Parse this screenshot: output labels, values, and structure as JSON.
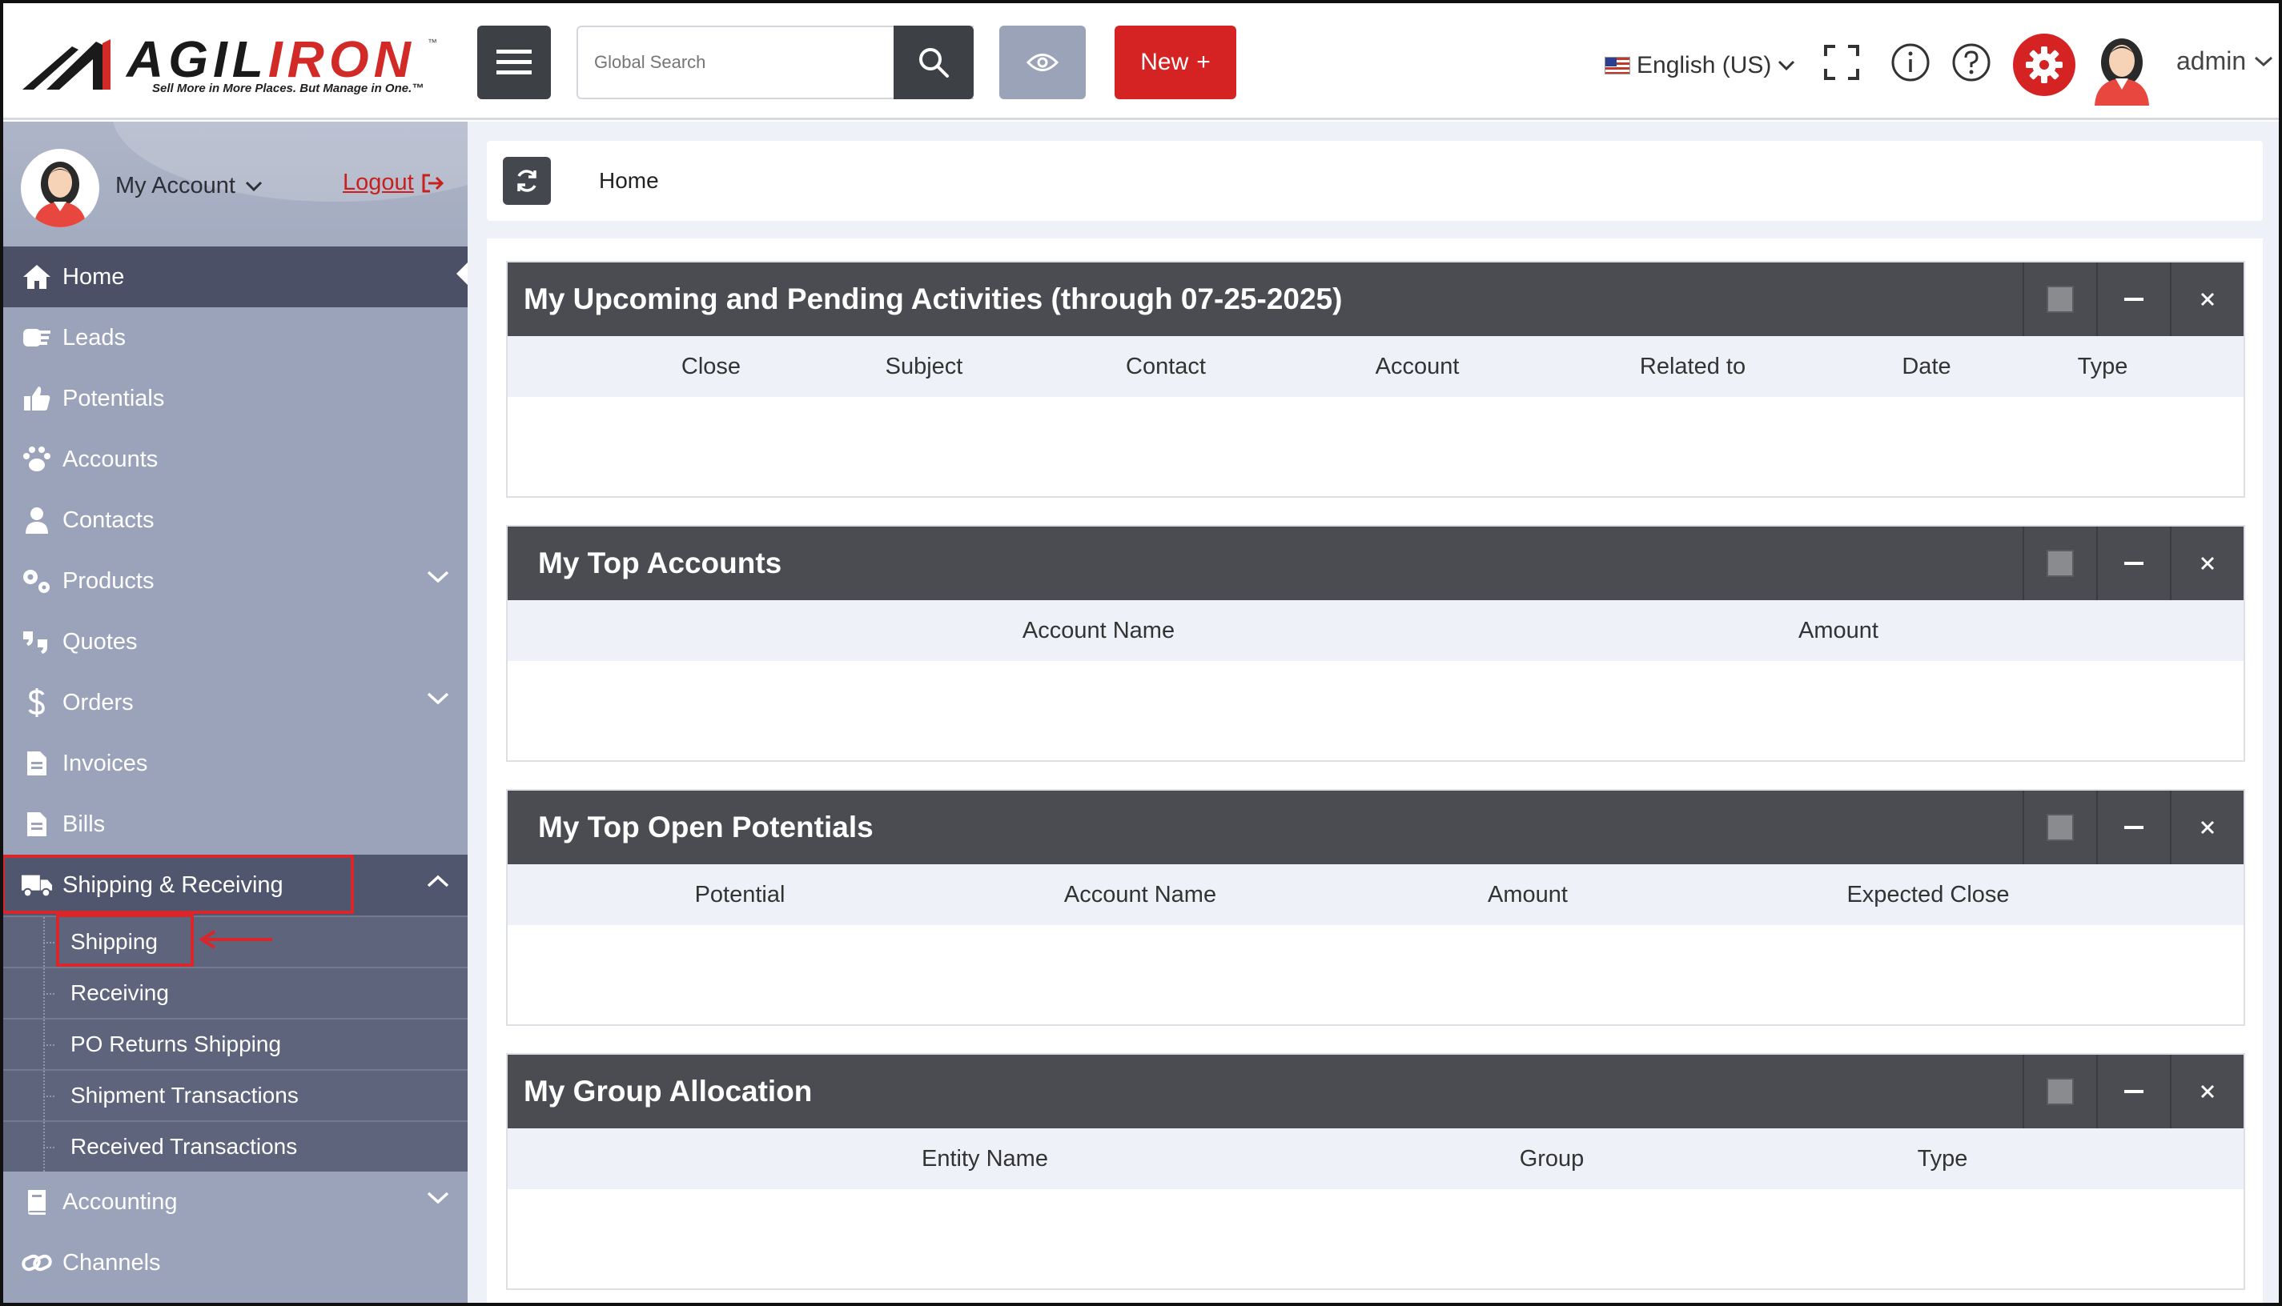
{
  "header": {
    "logo": {
      "word_part1": "AGIL",
      "word_part2": "IRON",
      "tm": "™",
      "tagline": "Sell More in More Places. But Manage in One.™"
    },
    "search_placeholder": "Global Search",
    "new_label": "New",
    "new_icon": "+",
    "language": "English (US)",
    "user": "admin"
  },
  "sidebar": {
    "my_account": "My Account",
    "logout": "Logout",
    "items": [
      {
        "label": "Home",
        "icon": "home-icon"
      },
      {
        "label": "Leads",
        "icon": "leads-icon"
      },
      {
        "label": "Potentials",
        "icon": "thumbs-up-icon"
      },
      {
        "label": "Accounts",
        "icon": "paw-icon"
      },
      {
        "label": "Contacts",
        "icon": "user-icon"
      },
      {
        "label": "Products",
        "icon": "gears-icon"
      },
      {
        "label": "Quotes",
        "icon": "quote-icon"
      },
      {
        "label": "Orders",
        "icon": "dollar-icon"
      },
      {
        "label": "Invoices",
        "icon": "invoice-icon"
      },
      {
        "label": "Bills",
        "icon": "bill-icon"
      },
      {
        "label": "Shipping & Receiving",
        "icon": "truck-icon"
      },
      {
        "label": "Accounting",
        "icon": "book-icon"
      },
      {
        "label": "Channels",
        "icon": "link-icon"
      }
    ],
    "shipping_sub": [
      "Shipping",
      "Receiving",
      "PO Returns Shipping",
      "Shipment Transactions",
      "Received Transactions"
    ]
  },
  "breadcrumb": {
    "home": "Home"
  },
  "widgets": [
    {
      "title": "My Upcoming and Pending Activities (through 07-25-2025)",
      "columns": [
        "Close",
        "Subject",
        "Contact",
        "Account",
        "Related to",
        "Date",
        "Type"
      ]
    },
    {
      "title": "My Top Accounts",
      "columns": [
        "Account Name",
        "Amount"
      ]
    },
    {
      "title": "My Top Open Potentials",
      "columns": [
        "Potential",
        "Account Name",
        "Amount",
        "Expected Close"
      ]
    },
    {
      "title": "My Group Allocation",
      "columns": [
        "Entity Name",
        "Group",
        "Type"
      ]
    }
  ],
  "colors": {
    "accent_red": "#d52323",
    "sidebar_bg": "#9aa3ba",
    "widget_header": "#4a4c52"
  }
}
